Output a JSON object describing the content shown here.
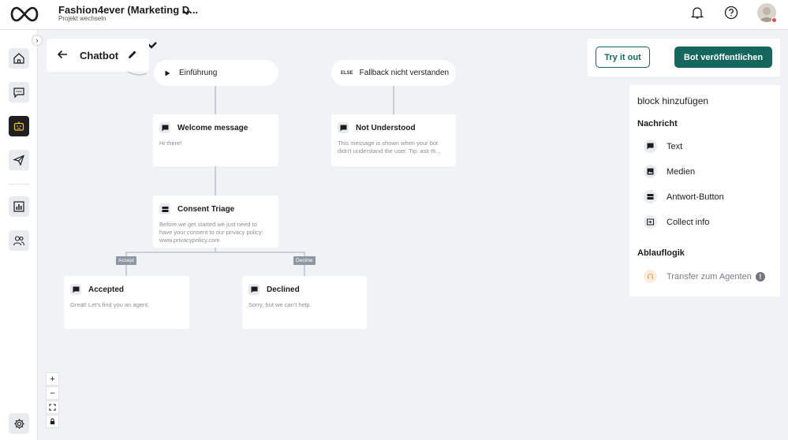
{
  "header": {
    "project_title": "Fashion4ever (Marketing D...",
    "project_subtitle": "Projekt wechseln"
  },
  "icons": {
    "logo": "infinity-logo-icon",
    "chevron": "chevron-down-icon",
    "bell": "bell-icon",
    "help": "help-icon",
    "avatar": "avatar"
  },
  "sidebar": {
    "items": [
      {
        "name": "home",
        "icon": "home-icon",
        "active": false
      },
      {
        "name": "conversations",
        "icon": "chat-icon",
        "active": false
      },
      {
        "name": "chatbot",
        "icon": "bot-icon",
        "active": true
      },
      {
        "name": "campaigns",
        "icon": "send-icon",
        "active": false
      },
      {
        "name": "analytics",
        "icon": "chart-icon",
        "active": false
      },
      {
        "name": "contacts",
        "icon": "users-icon",
        "active": false
      }
    ],
    "settings_icon": "gear-icon"
  },
  "canvas": {
    "title": "Chatbot",
    "pills": [
      {
        "tag": "",
        "label": "Einführung"
      },
      {
        "tag": "ELSE",
        "label": "Fallback nicht verstanden"
      }
    ],
    "nodes": [
      {
        "title": "Welcome message",
        "body": "Hi there!"
      },
      {
        "title": "Not Understood",
        "body": "This message is shown when your bot didn't understand the user. Tip: ask th..."
      },
      {
        "title": "Consent Triage",
        "body": "Before we get started we just need to have your consent to our privacy policy: www.privacypolicy.com"
      },
      {
        "title": "Accepted",
        "body": "Great! Let's find you an agent."
      },
      {
        "title": "Declined",
        "body": "Sorry, but we can't help."
      }
    ],
    "edge_labels": [
      "Accept",
      "Decline"
    ],
    "zoom_controls": [
      "+",
      "−",
      "⛶",
      "🔒"
    ]
  },
  "actions": {
    "try_label": "Try it out",
    "publish_label": "Bot veröffentlichen"
  },
  "block_panel": {
    "title": "block hinzufügen",
    "sections": [
      {
        "label": "Nachricht",
        "items": [
          "Text",
          "Medien",
          "Antwort-Button",
          "Collect info"
        ]
      },
      {
        "label": "Ablauflogik",
        "items": [
          "Transfer zum Agenten"
        ]
      }
    ],
    "warning_glyph": "!"
  },
  "colors": {
    "accent": "#14675c",
    "sidebar_active": "#1f1f1f",
    "edge_label": "#8e98a4",
    "canvas_bg": "#f0f2f5"
  }
}
